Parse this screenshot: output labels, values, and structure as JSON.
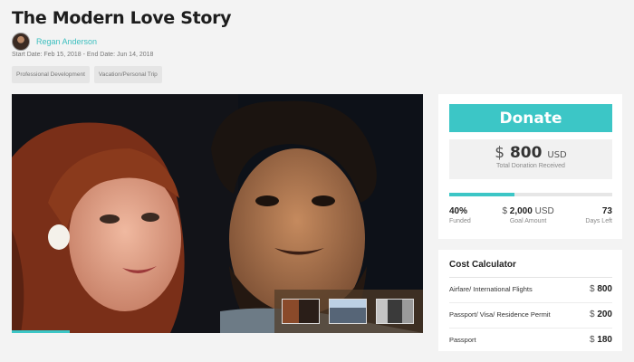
{
  "campaign": {
    "title": "The Modern Love Story",
    "author": "Regan Anderson",
    "dates": "Start Date: Feb 15, 2018 - End Date: Jun 14, 2018",
    "tags": [
      "Professional Development",
      "Vacation/Personal Trip"
    ]
  },
  "gallery": {
    "thumbnail_count": 3,
    "progress_fraction": 0.14
  },
  "donation": {
    "button_label": "Donate",
    "received_symbol": "$",
    "received_amount": "800",
    "received_currency": "USD",
    "received_label": "Total Donation Received",
    "progress_percent": 40,
    "funded_value": "40%",
    "funded_label": "Funded",
    "goal_symbol": "$",
    "goal_amount": "2,000",
    "goal_currency": "USD",
    "goal_label": "Goal Amount",
    "days_value": "73",
    "days_label": "Days Left"
  },
  "calculator": {
    "title": "Cost Calculator",
    "rows": [
      {
        "label": "Airfare/ International Flights",
        "symbol": "$",
        "amount": "800"
      },
      {
        "label": "Passport/ Visa/ Residence Permit",
        "symbol": "$",
        "amount": "200"
      },
      {
        "label": "Passport",
        "symbol": "$",
        "amount": "180"
      }
    ]
  },
  "colors": {
    "accent": "#3cc6c6",
    "author_link": "#3cbfbf",
    "background": "#f3f3f3"
  },
  "icons": {
    "avatar": "user-avatar-photo"
  }
}
